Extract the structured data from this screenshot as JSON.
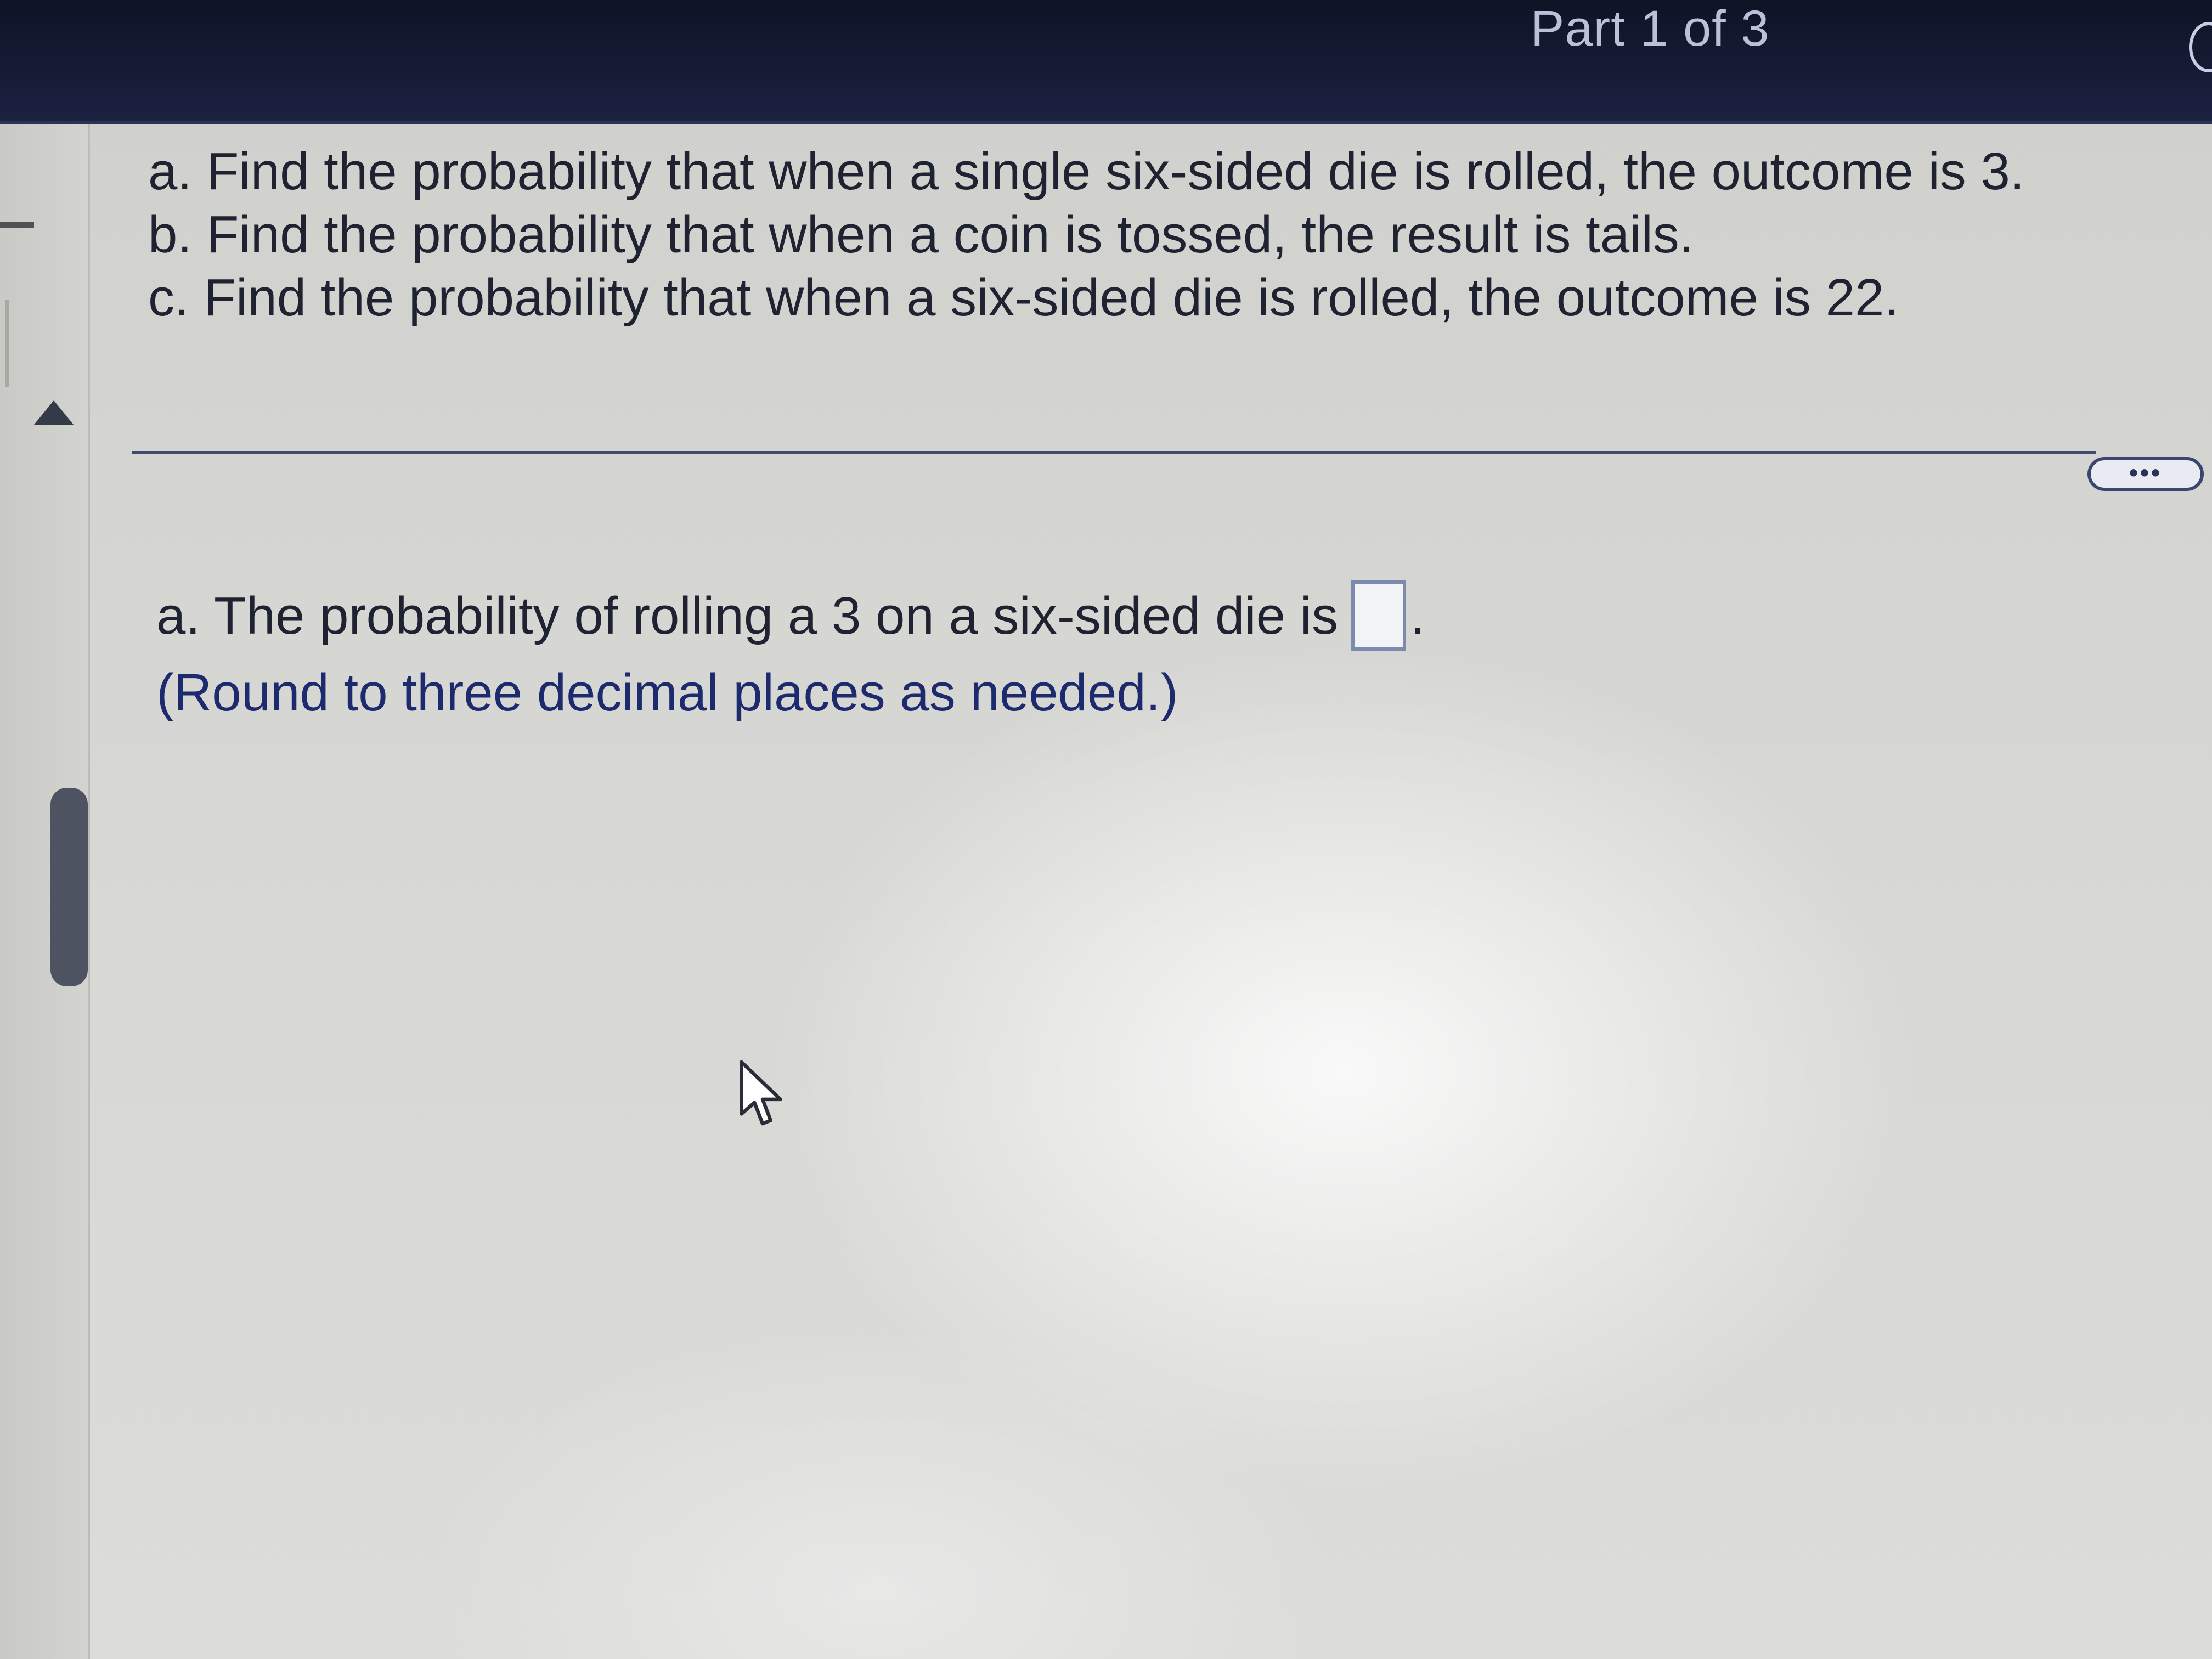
{
  "header": {
    "part_indicator": "Part 1 of 3"
  },
  "question": {
    "lines": [
      "a. Find the probability that when a single six-sided die is rolled, the outcome is 3.",
      "b. Find the probability that when a coin is tossed, the result is tails.",
      "c. Find the probability that when a six-sided die is rolled, the outcome is 22."
    ]
  },
  "toolbar": {
    "more_label": "•••"
  },
  "answer": {
    "prompt": "a. The probability of rolling a 3 on a six-sided die is",
    "input_value": "",
    "suffix": ".",
    "hint": "(Round to three decimal places as needed.)"
  },
  "icons": {
    "cursor": "mouse-pointer-icon",
    "collapse": "triangle-up-icon"
  },
  "colors": {
    "header_bg": "#141a33",
    "hint_text": "#1d2a6e",
    "divider": "#3f4a70"
  }
}
